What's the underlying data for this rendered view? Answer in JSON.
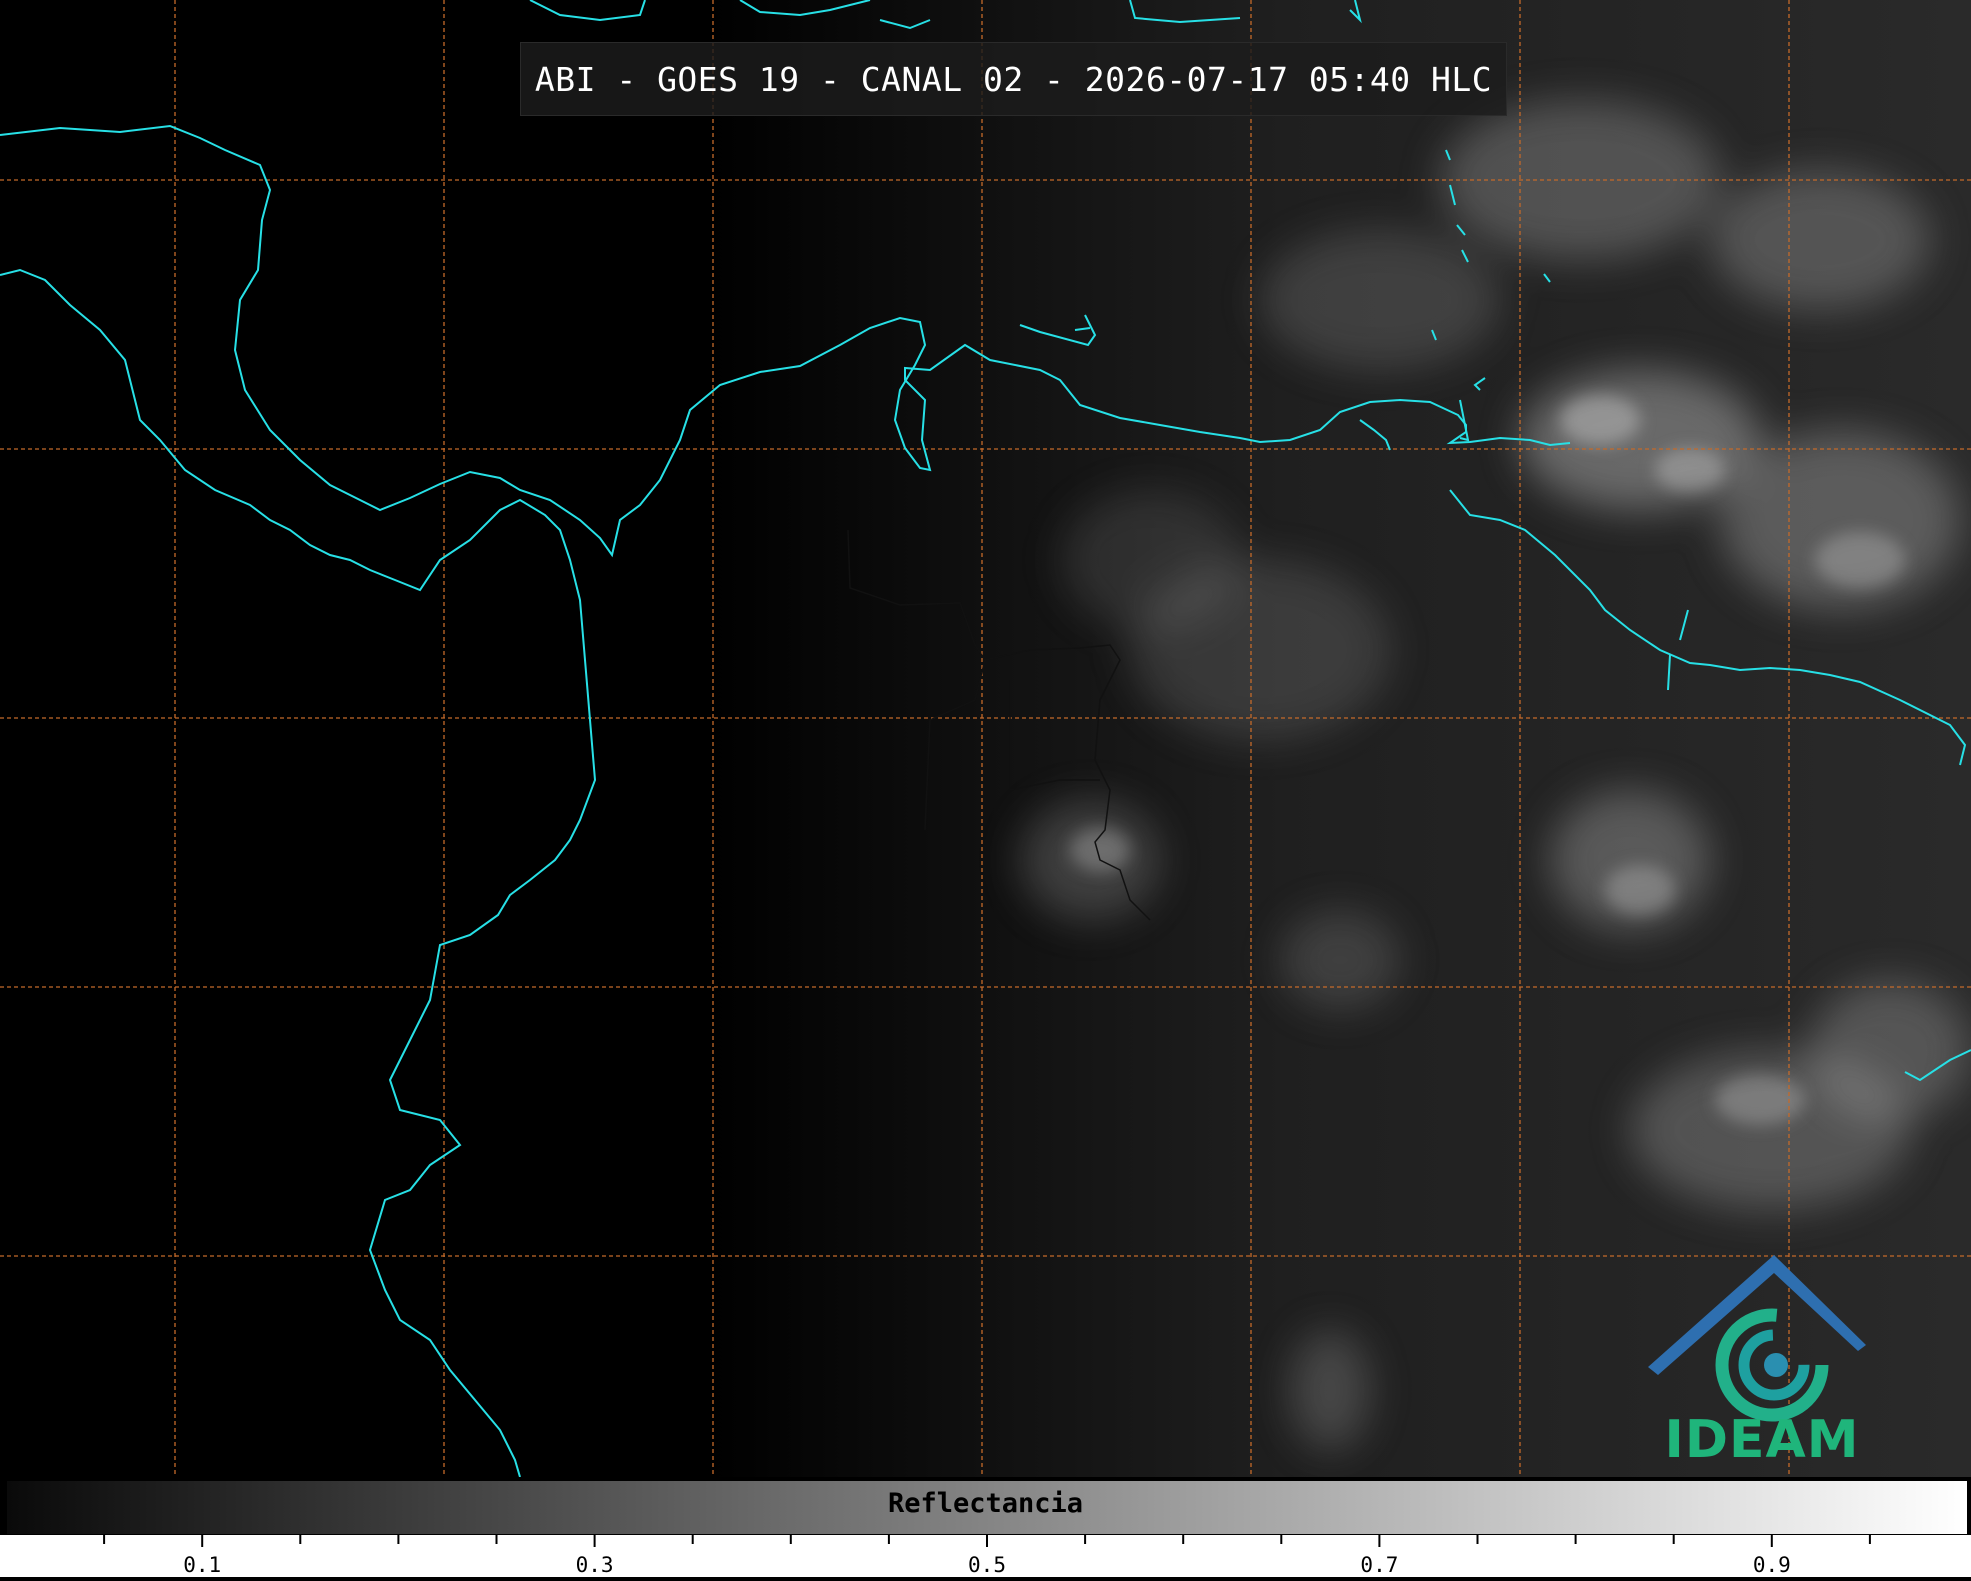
{
  "title": "ABI - GOES 19 - CANAL 02 - 2026-07-17 05:40 HLC",
  "logo": {
    "text": "IDEAM",
    "text_color": "#1fb57b",
    "roof_color": "#2e6fb0",
    "swirl_color": "#22b08a"
  },
  "colors": {
    "coastline": "#27e0e6",
    "gridline": "#c46a2a",
    "border": "#111111"
  },
  "colorbar": {
    "label": "Reflectancia",
    "min": 0.0,
    "max": 1.0,
    "gradient_start": "#0a0a0a",
    "gradient_end": "#ffffff",
    "tick_labels": [
      "0.1",
      "0.3",
      "0.5",
      "0.7",
      "0.9"
    ],
    "tick_values": [
      0.1,
      0.3,
      0.5,
      0.7,
      0.9
    ],
    "minor_step": 0.05
  },
  "grid": {
    "style": "dashed",
    "columns": 7,
    "rows": 5
  }
}
